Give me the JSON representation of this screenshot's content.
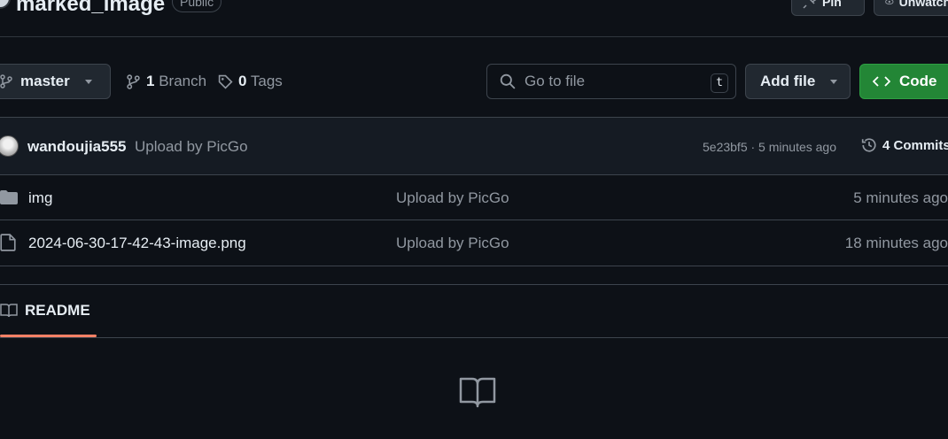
{
  "header": {
    "repo_name": "marked_image",
    "visibility": "Public",
    "pin_label": "Pin",
    "unwatch_label": "Unwatch"
  },
  "toolbar": {
    "branch": "master",
    "branch_count": "1",
    "branch_label": "Branch",
    "tag_count": "0",
    "tag_label": "Tags",
    "search_placeholder": "Go to file",
    "search_shortcut": "t",
    "add_file_label": "Add file",
    "code_label": "Code"
  },
  "latest_commit": {
    "author": "wandoujia555",
    "message": "Upload by PicGo",
    "meta": "5e23bf5 · 5 minutes ago",
    "commits_label": "4 Commits"
  },
  "files": [
    {
      "type": "folder",
      "name": "img",
      "commit_message": "Upload by PicGo",
      "time": "5 minutes ago"
    },
    {
      "type": "file",
      "name": "2024-06-30-17-42-43-image.png",
      "commit_message": "Upload by PicGo",
      "time": "18 minutes ago"
    }
  ],
  "readme": {
    "tab_label": "README"
  },
  "colors": {
    "background": "#0d1117",
    "code_button": "#238636",
    "readme_accent": "#f78166"
  }
}
